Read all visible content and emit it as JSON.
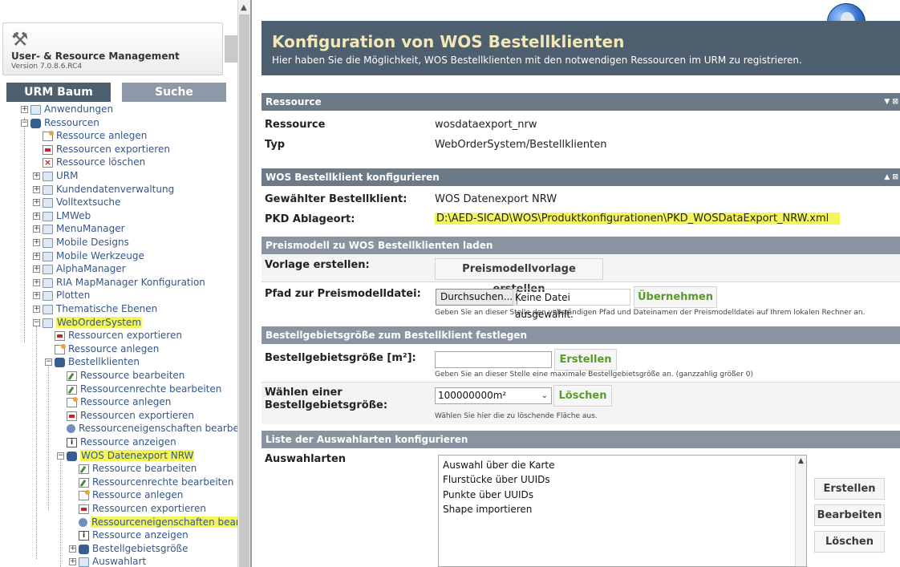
{
  "app": {
    "title": "User- & Resource Management",
    "version": "Version 7.0.8.6.RC4"
  },
  "tabs": {
    "tree": "URM Baum",
    "search": "Suche"
  },
  "tree": [
    {
      "label": "Anwendungen",
      "indent": 1,
      "icon": "folder",
      "expander": "+"
    },
    {
      "label": "Ressourcen",
      "indent": 1,
      "icon": "db",
      "expander": "-"
    },
    {
      "label": "Ressource anlegen",
      "indent": 2,
      "icon": "doc",
      "expander": ""
    },
    {
      "label": "Ressourcen exportieren",
      "indent": 2,
      "icon": "exp-red",
      "expander": ""
    },
    {
      "label": "Ressource löschen",
      "indent": 2,
      "icon": "del",
      "expander": ""
    },
    {
      "label": "URM",
      "indent": 2,
      "icon": "folder",
      "expander": "+"
    },
    {
      "label": "Kundendatenverwaltung",
      "indent": 2,
      "icon": "folder",
      "expander": "+"
    },
    {
      "label": "Volltextsuche",
      "indent": 2,
      "icon": "folder",
      "expander": "+"
    },
    {
      "label": "LMWeb",
      "indent": 2,
      "icon": "folder",
      "expander": "+"
    },
    {
      "label": "MenuManager",
      "indent": 2,
      "icon": "folder",
      "expander": "+"
    },
    {
      "label": "Mobile Designs",
      "indent": 2,
      "icon": "folder",
      "expander": "+"
    },
    {
      "label": "Mobile Werkzeuge",
      "indent": 2,
      "icon": "folder",
      "expander": "+"
    },
    {
      "label": "AlphaManager",
      "indent": 2,
      "icon": "folder",
      "expander": "+"
    },
    {
      "label": "RIA MapManager Konfiguration",
      "indent": 2,
      "icon": "folder",
      "expander": "+"
    },
    {
      "label": "Plotten",
      "indent": 2,
      "icon": "folder",
      "expander": "+"
    },
    {
      "label": "Thematische Ebenen",
      "indent": 2,
      "icon": "folder",
      "expander": "+"
    },
    {
      "label": "WebOrderSystem",
      "indent": 2,
      "icon": "folder",
      "expander": "-",
      "highlight": true
    },
    {
      "label": "Ressourcen exportieren",
      "indent": 3,
      "icon": "exp-red",
      "expander": ""
    },
    {
      "label": "Ressource anlegen",
      "indent": 3,
      "icon": "doc",
      "expander": ""
    },
    {
      "label": "Bestellklienten",
      "indent": 3,
      "icon": "db",
      "expander": "-"
    },
    {
      "label": "Ressource bearbeiten",
      "indent": 4,
      "icon": "edit",
      "expander": ""
    },
    {
      "label": "Ressourcenrechte bearbeiten",
      "indent": 4,
      "icon": "edit",
      "expander": ""
    },
    {
      "label": "Ressource anlegen",
      "indent": 4,
      "icon": "doc",
      "expander": ""
    },
    {
      "label": "Ressourcen exportieren",
      "indent": 4,
      "icon": "exp-red",
      "expander": ""
    },
    {
      "label": "Ressourceneigenschaften bearbeiten",
      "indent": 4,
      "icon": "gear",
      "expander": ""
    },
    {
      "label": "Ressource anzeigen",
      "indent": 4,
      "icon": "info",
      "expander": ""
    },
    {
      "label": "WOS Datenexport NRW",
      "indent": 4,
      "icon": "db",
      "expander": "-",
      "highlight": true
    },
    {
      "label": "Ressource bearbeiten",
      "indent": 5,
      "icon": "edit",
      "expander": ""
    },
    {
      "label": "Ressourcenrechte bearbeiten",
      "indent": 5,
      "icon": "edit",
      "expander": ""
    },
    {
      "label": "Ressource anlegen",
      "indent": 5,
      "icon": "doc",
      "expander": ""
    },
    {
      "label": "Ressourcen exportieren",
      "indent": 5,
      "icon": "exp-red",
      "expander": ""
    },
    {
      "label": "Ressourceneigenschaften bearbeit",
      "indent": 5,
      "icon": "gear",
      "expander": "",
      "highlight": true
    },
    {
      "label": "Ressource anzeigen",
      "indent": 5,
      "icon": "info",
      "expander": ""
    },
    {
      "label": "Bestellgebietsgröße",
      "indent": 5,
      "icon": "db",
      "expander": "+"
    },
    {
      "label": "Auswahlart",
      "indent": 5,
      "icon": "folder",
      "expander": "+"
    }
  ],
  "header": {
    "title": "Konfiguration von WOS Bestellklienten",
    "subtitle": "Hier haben Sie die Möglichkeit, WOS Bestellklienten mit den notwendigen Ressourcen im URM zu registrieren."
  },
  "ressource": {
    "section": "Ressource",
    "rows": [
      {
        "label": "Ressource",
        "value": "wosdataexport_nrw"
      },
      {
        "label": "Typ",
        "value": "WebOrderSystem/Bestellklienten"
      }
    ]
  },
  "wos_config": {
    "section": "WOS Bestellklient konfigurieren",
    "rows": [
      {
        "label": "Gewählter Bestellklient:",
        "value": "WOS Datenexport NRW"
      },
      {
        "label": "PKD Ablageort:",
        "value": "D:\\AED-SICAD\\WOS\\Produktkonfigurationen\\PKD_WOSDataExport_NRW.xml"
      }
    ]
  },
  "preismodell": {
    "section": "Preismodell zu WOS Bestellklienten laden",
    "vorlage_label": "Vorlage erstellen:",
    "vorlage_button": "Preismodellvorlage erstellen",
    "pfad_label": "Pfad zur Preismodelldatei:",
    "browse_button": "Durchsuchen...",
    "no_file": "Keine Datei ausgewählt.",
    "apply_button": "Übernehmen",
    "hint": "Geben Sie an dieser Stelle den vollständigen Pfad und Dateinamen der Preismodelldatei auf Ihrem lokalen Rechner an."
  },
  "gebiet": {
    "section": "Bestellgebietsgröße zum Bestellklient festlegen",
    "size_label": "Bestellgebietsgröße [m²]:",
    "size_value": "",
    "create_button": "Erstellen",
    "size_hint": "Geben Sie an dieser Stelle eine maximale Bestellgebietsgröße an. (ganzzahlig größer 0)",
    "select_label_1": "Wählen einer",
    "select_label_2": "Bestellgebietsgröße:",
    "selected": "100000000m²",
    "delete_button": "Löschen",
    "select_hint": "Wählen Sie hier die zu löschende Fläche aus."
  },
  "auswahl": {
    "section": "Liste der Auswahlarten konfigurieren",
    "label": "Auswahlarten",
    "options": [
      "Auswahl über die Karte",
      "Flurstücke über UUIDs",
      "Punkte über UUIDs",
      "Shape importieren"
    ],
    "create_button": "Erstellen",
    "edit_button": "Bearbeiten",
    "delete_button": "Löschen"
  },
  "colors": {
    "header_bg": "#4e5f70",
    "section_bg": "#6c7a88",
    "highlight": "#f4f45c",
    "action_green": "#5a9a2b"
  }
}
